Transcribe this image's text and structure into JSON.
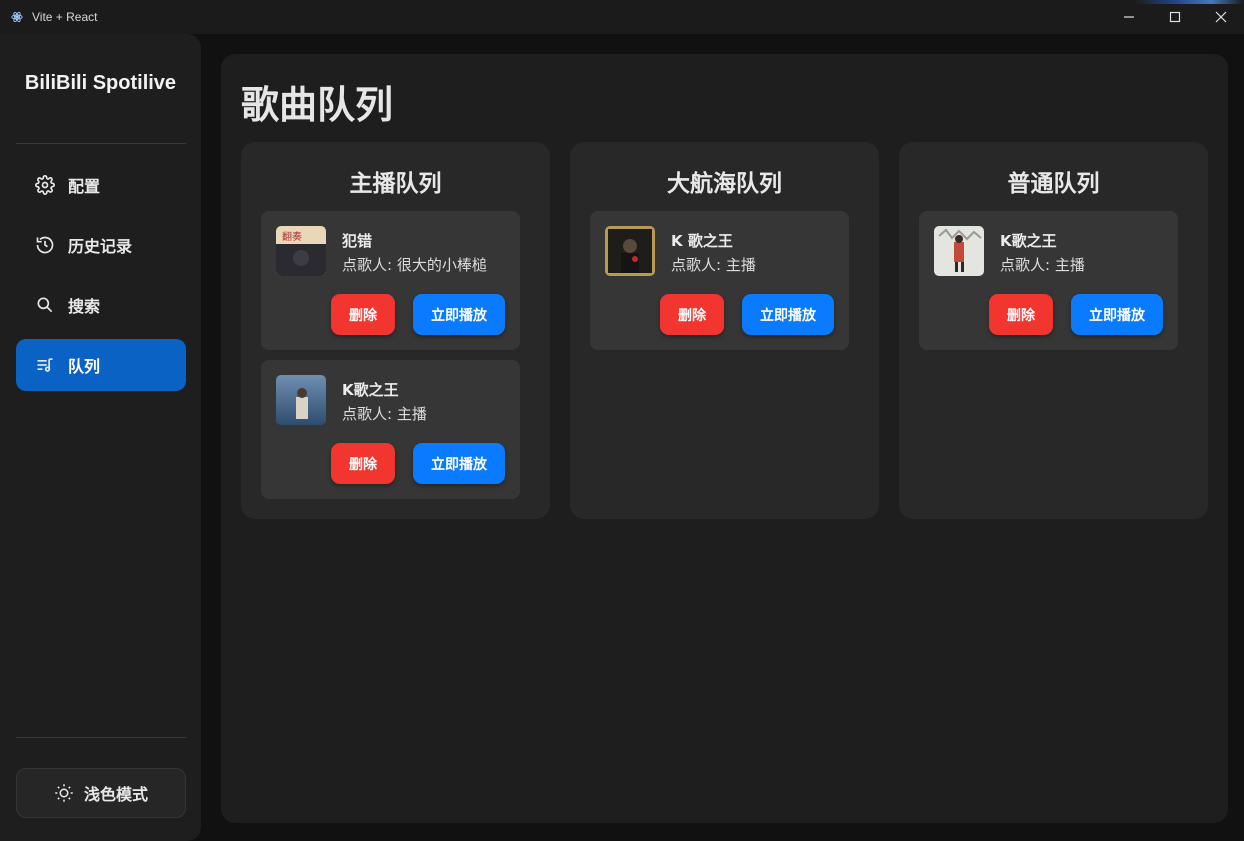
{
  "window": {
    "title": "Vite + React"
  },
  "sidebar": {
    "brand": "BiliBili Spotilive",
    "items": [
      {
        "label": "配置",
        "icon": "gear-icon"
      },
      {
        "label": "历史记录",
        "icon": "history-icon"
      },
      {
        "label": "搜索",
        "icon": "search-icon"
      },
      {
        "label": "队列",
        "icon": "queue-music-icon",
        "active": true
      }
    ],
    "theme_toggle": {
      "label": "浅色模式",
      "icon": "sun-icon"
    }
  },
  "main": {
    "title": "歌曲队列",
    "columns": [
      {
        "title": "主播队列",
        "cards": [
          {
            "song": "犯错",
            "requester": "点歌人: 很大的小棒槌",
            "delete_label": "删除",
            "play_label": "立即播放"
          },
          {
            "song": "K歌之王",
            "requester": "点歌人: 主播",
            "delete_label": "删除",
            "play_label": "立即播放"
          }
        ]
      },
      {
        "title": "大航海队列",
        "cards": [
          {
            "song": "K 歌之王",
            "requester": "点歌人: 主播",
            "delete_label": "删除",
            "play_label": "立即播放"
          }
        ]
      },
      {
        "title": "普通队列",
        "cards": [
          {
            "song": "K歌之王",
            "requester": "点歌人: 主播",
            "delete_label": "删除",
            "play_label": "立即播放"
          }
        ]
      }
    ]
  },
  "colors": {
    "accent": "#0a62c4",
    "delete": "#f2362f",
    "play": "#0a7bff",
    "panel": "#1e1e1e",
    "card": "#363636"
  }
}
